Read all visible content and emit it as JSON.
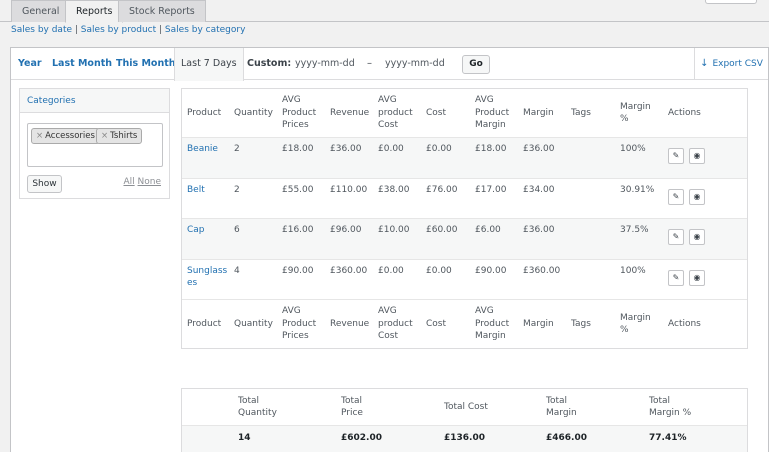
{
  "top_tabs": [
    "General",
    "Reports",
    "Stock Reports"
  ],
  "sublinks": [
    "Sales by date",
    "Sales by product",
    "Sales by category"
  ],
  "ranges": [
    "Year",
    "Last Month",
    "This Month",
    "Last 7 Days"
  ],
  "custom": {
    "label": "Custom:",
    "from_placeholder": "yyyy-mm-dd",
    "dash": "–",
    "to_placeholder": "yyyy-mm-dd",
    "go": "Go"
  },
  "export_label": "Export CSV",
  "sidebar": {
    "title": "Categories",
    "chips": [
      "Accessories",
      "Tshirts"
    ],
    "show": "Show",
    "all": "All",
    "none": "None"
  },
  "table": {
    "headers": [
      [
        "Product"
      ],
      [
        "Quantity"
      ],
      [
        "AVG",
        "Product",
        "Prices"
      ],
      [
        "Revenue"
      ],
      [
        "AVG",
        "product",
        "Cost"
      ],
      [
        "Cost"
      ],
      [
        "AVG",
        "Product",
        "Margin"
      ],
      [
        "Margin"
      ],
      [
        "Tags"
      ],
      [
        "Margin",
        "%"
      ],
      [
        "Actions"
      ]
    ],
    "rows": [
      {
        "product": [
          "Beanie"
        ],
        "qty": "2",
        "avg_price": "£18.00",
        "revenue": "£36.00",
        "avg_cost": "£0.00",
        "cost": "£0.00",
        "avg_margin": "£18.00",
        "margin": "£36.00",
        "tags": "",
        "margin_pct": "100%"
      },
      {
        "product": [
          "Belt"
        ],
        "qty": "2",
        "avg_price": "£55.00",
        "revenue": "£110.00",
        "avg_cost": "£38.00",
        "cost": "£76.00",
        "avg_margin": "£17.00",
        "margin": "£34.00",
        "tags": "",
        "margin_pct": "30.91%"
      },
      {
        "product": [
          "Cap"
        ],
        "qty": "6",
        "avg_price": "£16.00",
        "revenue": "£96.00",
        "avg_cost": "£10.00",
        "cost": "£60.00",
        "avg_margin": "£6.00",
        "margin": "£36.00",
        "tags": "",
        "margin_pct": "37.5%"
      },
      {
        "product": [
          "Sunglass",
          "es"
        ],
        "qty": "4",
        "avg_price": "£90.00",
        "revenue": "£360.00",
        "avg_cost": "£0.00",
        "cost": "£0.00",
        "avg_margin": "£90.00",
        "margin": "£360.00",
        "tags": "",
        "margin_pct": "100%"
      }
    ],
    "action_icons": [
      "edit-icon",
      "view-icon"
    ]
  },
  "totals": {
    "headers": [
      [
        "Total",
        "Quantity"
      ],
      [
        "Total",
        "Price"
      ],
      [
        "Total Cost"
      ],
      [
        "Total",
        "Margin"
      ],
      [
        "Total",
        "Margin %"
      ]
    ],
    "values": [
      "14",
      "£602.00",
      "£136.00",
      "£466.00",
      "77.41%"
    ]
  }
}
